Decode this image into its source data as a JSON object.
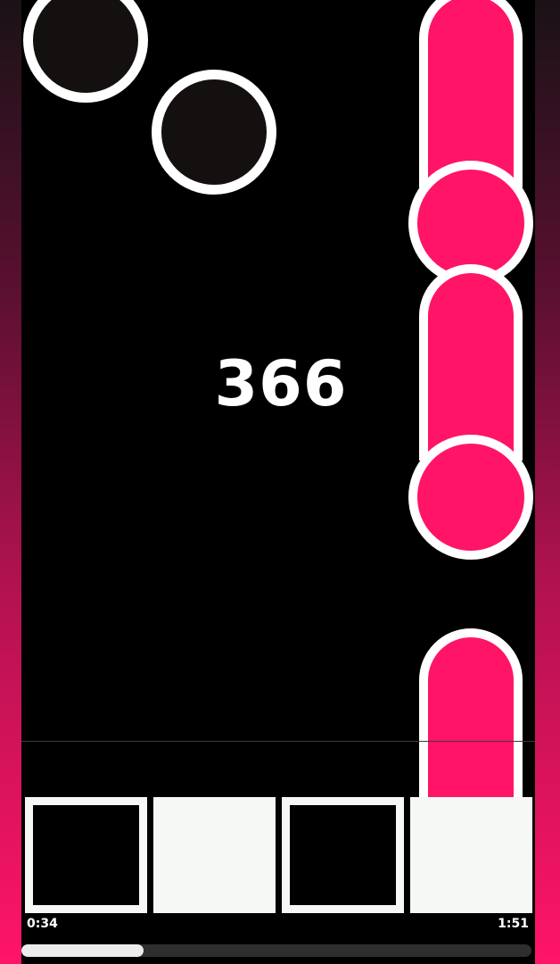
{
  "game": {
    "score": "366",
    "accent_color": "#ff1468",
    "note_color": "#141010",
    "outline_color": "#ffffff"
  },
  "lanes": [
    {
      "key_state": "outline"
    },
    {
      "key_state": "filled"
    },
    {
      "key_state": "outline"
    },
    {
      "key_state": "filled"
    }
  ],
  "progress": {
    "elapsed": "0:34",
    "total": "1:51",
    "fraction": 0.24
  }
}
